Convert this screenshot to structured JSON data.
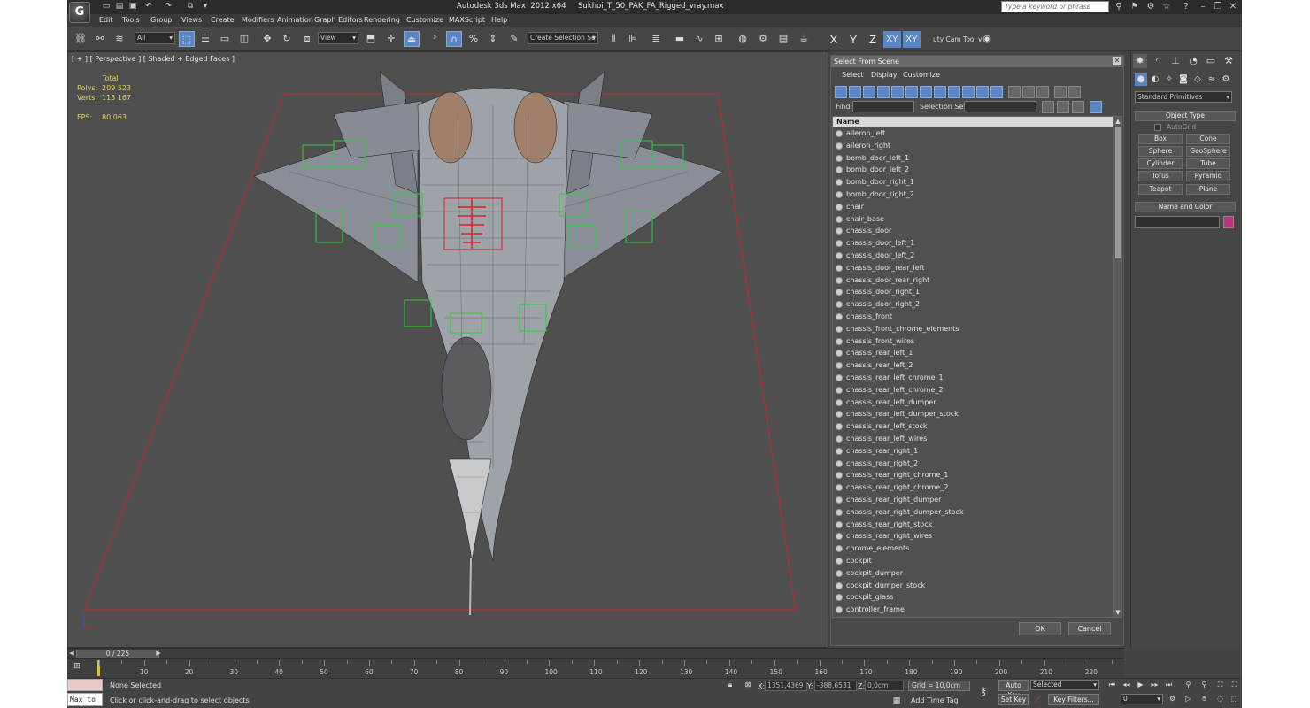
{
  "titlebar": {
    "app_name": "Autodesk 3ds Max  2012 x64",
    "file_name": "Sukhoi_T_50_PAK_FA_Rigged_vray.max",
    "search_placeholder": "Type a keyword or phrase",
    "logo": "G"
  },
  "menu": [
    "Edit",
    "Tools",
    "Group",
    "Views",
    "Create",
    "Modifiers",
    "Animation",
    "Graph Editors",
    "Rendering",
    "Customize",
    "MAXScript",
    "Help"
  ],
  "toolbar": {
    "filter_value": "All",
    "refcoord_value": "View",
    "selection_set_placeholder": "Create Selection Se",
    "axes": [
      "X",
      "Y",
      "Z",
      "XY",
      "XY"
    ],
    "cam_tool": "uty Cam Tool v"
  },
  "viewport": {
    "label": "[ + ] [ Perspective ] [ Shaded + Edged Faces ]",
    "stats": {
      "header": "Total",
      "polys_label": "Polys:",
      "polys_value": "209 523",
      "verts_label": "Verts:",
      "verts_value": "113 167",
      "fps_label": "FPS:",
      "fps_value": "80,063"
    }
  },
  "select_dialog": {
    "title": "Select From Scene",
    "menus": [
      "Select",
      "Display",
      "Customize"
    ],
    "find_label": "Find:",
    "selection_set_label": "Selection Set:",
    "column_header": "Name",
    "items": [
      "aileron_left",
      "aileron_right",
      "bomb_door_left_1",
      "bomb_door_left_2",
      "bomb_door_right_1",
      "bomb_door_right_2",
      "chair",
      "chair_base",
      "chassis_door",
      "chassis_door_left_1",
      "chassis_door_left_2",
      "chassis_door_rear_left",
      "chassis_door_rear_right",
      "chassis_door_right_1",
      "chassis_door_right_2",
      "chassis_front",
      "chassis_front_chrome_elements",
      "chassis_front_wires",
      "chassis_rear_left_1",
      "chassis_rear_left_2",
      "chassis_rear_left_chrome_1",
      "chassis_rear_left_chrome_2",
      "chassis_rear_left_dumper",
      "chassis_rear_left_dumper_stock",
      "chassis_rear_left_stock",
      "chassis_rear_left_wires",
      "chassis_rear_right_1",
      "chassis_rear_right_2",
      "chassis_rear_right_chrome_1",
      "chassis_rear_right_chrome_2",
      "chassis_rear_right_dumper",
      "chassis_rear_right_dumper_stock",
      "chassis_rear_right_stock",
      "chassis_rear_right_wires",
      "chrome_elements",
      "cockpit",
      "cockpit_dumper",
      "cockpit_dumper_stock",
      "cockpit_glass",
      "controller_frame"
    ],
    "ok_label": "OK",
    "cancel_label": "Cancel"
  },
  "command_panel": {
    "category_value": "Standard Primitives",
    "object_type_label": "Object Type",
    "autogrid_label": "AutoGrid",
    "primitives": [
      "Box",
      "Cone",
      "Sphere",
      "GeoSphere",
      "Cylinder",
      "Tube",
      "Torus",
      "Pyramid",
      "Teapot",
      "Plane"
    ],
    "name_color_label": "Name and Color",
    "swatch_color": "#c0337f"
  },
  "timeline": {
    "slider_label": "0 / 225",
    "ticks": [
      "10",
      "20",
      "30",
      "40",
      "50",
      "60",
      "70",
      "80",
      "90",
      "100",
      "110",
      "120",
      "130",
      "140",
      "150",
      "160",
      "170",
      "180",
      "190",
      "200",
      "210",
      "220"
    ]
  },
  "status": {
    "selection": "None Selected",
    "prompt": "Click or click-and-drag to select objects",
    "maxscript_label": "Max to",
    "x_label": "X:",
    "x_value": "1351,4369",
    "y_label": "Y:",
    "y_value": "-388,6531",
    "z_label": "Z:",
    "z_value": "0,0cm",
    "grid": "Grid = 10,0cm",
    "add_time_tag": "Add Time Tag",
    "auto_key": "Auto Key",
    "set_key": "Set Key",
    "selected_value": "Selected",
    "key_filters": "Key Filters...",
    "frame_value": "0"
  }
}
